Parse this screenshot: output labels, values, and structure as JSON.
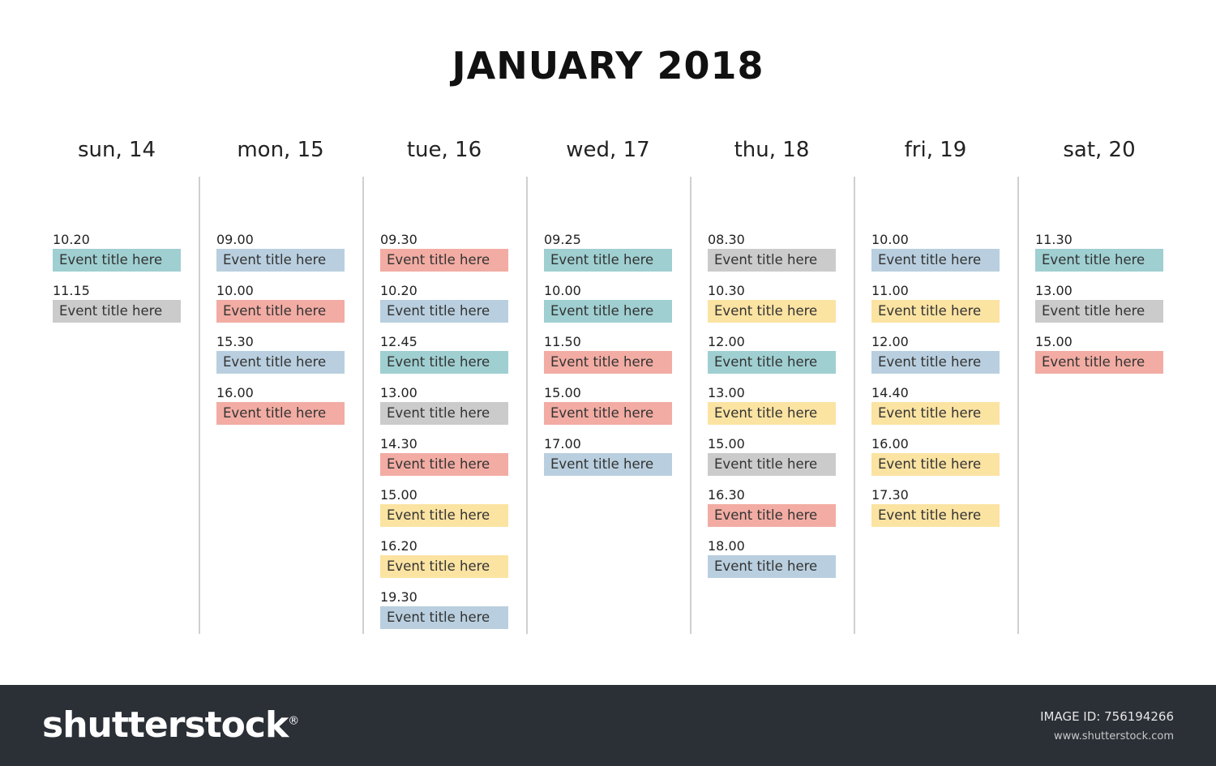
{
  "title": "JANUARY 2018",
  "colors": {
    "teal": "#9fcfd1",
    "gray": "#cbcbcb",
    "blue": "#b9cfdf",
    "red": "#f2aca3",
    "yellow": "#fbe3a2",
    "divider": "#cfcfcf",
    "footer": "#2b2f36"
  },
  "days": [
    {
      "label": "sun, 14",
      "events": [
        {
          "time": "10.20",
          "title": "Event title here",
          "color": "teal"
        },
        {
          "time": "11.15",
          "title": "Event title here",
          "color": "gray"
        }
      ]
    },
    {
      "label": "mon, 15",
      "events": [
        {
          "time": "09.00",
          "title": "Event title here",
          "color": "blue"
        },
        {
          "time": "10.00",
          "title": "Event title here",
          "color": "red"
        },
        {
          "time": "15.30",
          "title": "Event title here",
          "color": "blue"
        },
        {
          "time": "16.00",
          "title": "Event title here",
          "color": "red"
        }
      ]
    },
    {
      "label": "tue, 16",
      "events": [
        {
          "time": "09.30",
          "title": "Event title here",
          "color": "red"
        },
        {
          "time": "10.20",
          "title": "Event title here",
          "color": "blue"
        },
        {
          "time": "12.45",
          "title": "Event title here",
          "color": "teal"
        },
        {
          "time": "13.00",
          "title": "Event title here",
          "color": "gray"
        },
        {
          "time": "14.30",
          "title": "Event title here",
          "color": "red"
        },
        {
          "time": "15.00",
          "title": "Event title here",
          "color": "yellow"
        },
        {
          "time": "16.20",
          "title": "Event title here",
          "color": "yellow"
        },
        {
          "time": "19.30",
          "title": "Event title here",
          "color": "blue"
        }
      ]
    },
    {
      "label": "wed, 17",
      "events": [
        {
          "time": "09.25",
          "title": "Event title here",
          "color": "teal"
        },
        {
          "time": "10.00",
          "title": "Event title here",
          "color": "teal"
        },
        {
          "time": "11.50",
          "title": "Event title here",
          "color": "red"
        },
        {
          "time": "15.00",
          "title": "Event title here",
          "color": "red"
        },
        {
          "time": "17.00",
          "title": "Event title here",
          "color": "blue"
        }
      ]
    },
    {
      "label": "thu, 18",
      "events": [
        {
          "time": "08.30",
          "title": "Event title here",
          "color": "gray"
        },
        {
          "time": "10.30",
          "title": "Event title here",
          "color": "yellow"
        },
        {
          "time": "12.00",
          "title": "Event title here",
          "color": "teal"
        },
        {
          "time": "13.00",
          "title": "Event title here",
          "color": "yellow"
        },
        {
          "time": "15.00",
          "title": "Event title here",
          "color": "gray"
        },
        {
          "time": "16.30",
          "title": "Event title here",
          "color": "red"
        },
        {
          "time": "18.00",
          "title": "Event title here",
          "color": "blue"
        }
      ]
    },
    {
      "label": "fri, 19",
      "events": [
        {
          "time": "10.00",
          "title": "Event title here",
          "color": "blue"
        },
        {
          "time": "11.00",
          "title": "Event title here",
          "color": "yellow"
        },
        {
          "time": "12.00",
          "title": "Event title here",
          "color": "blue"
        },
        {
          "time": "14.40",
          "title": "Event title here",
          "color": "yellow"
        },
        {
          "time": "16.00",
          "title": "Event title here",
          "color": "yellow"
        },
        {
          "time": "17.30",
          "title": "Event title here",
          "color": "yellow"
        }
      ]
    },
    {
      "label": "sat, 20",
      "events": [
        {
          "time": "11.30",
          "title": "Event title here",
          "color": "teal"
        },
        {
          "time": "13.00",
          "title": "Event title here",
          "color": "gray"
        },
        {
          "time": "15.00",
          "title": "Event title here",
          "color": "red"
        }
      ]
    }
  ],
  "footer": {
    "brand": "shutterstock",
    "brand_mark": "®",
    "image_id": "IMAGE ID: 756194266",
    "site": "www.shutterstock.com"
  }
}
